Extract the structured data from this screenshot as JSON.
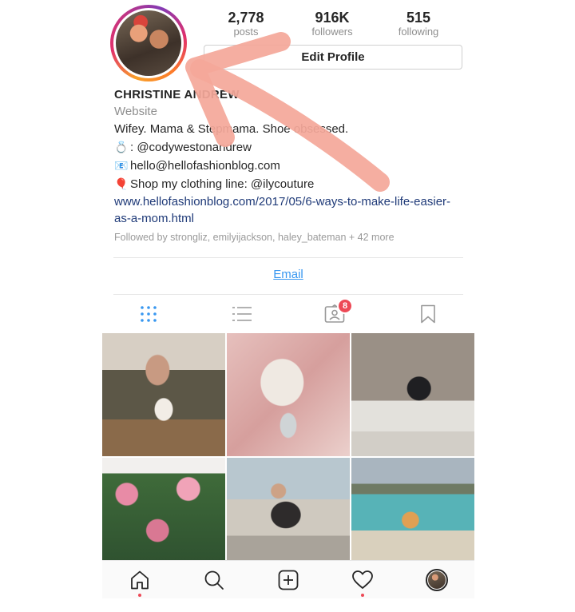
{
  "profile": {
    "posts_count": "2,778",
    "posts_label": "posts",
    "followers_count": "916K",
    "followers_label": "followers",
    "following_count": "515",
    "following_label": "following",
    "edit_button": "Edit Profile",
    "name": "CHRISTINE ANDREW",
    "website_label": "Website",
    "bio_line1": "Wifey. Mama & Stepmama. Shoe obsessed.",
    "bio_line2_glyph": "💍",
    "bio_line2": ": @codywestonandrew",
    "bio_line3_glyph": "📧",
    "bio_line3": "hello@hellofashionblog.com",
    "bio_line4_glyph": "🎈",
    "bio_line4": "Shop my clothing line: @ilycouture",
    "link": "www.hellofashionblog.com/2017/05/6-ways-to-make-life-easier-as-a-mom.html",
    "followed_by": "Followed by strongliz, emilyijackson, haley_bateman + 42 more",
    "email_button": "Email"
  },
  "tabs": {
    "items": [
      "grid-icon",
      "list-icon",
      "tagged-icon",
      "saved-icon"
    ],
    "tagged_badge": "8"
  },
  "grid": {
    "tiles": [
      "tile-1",
      "tile-2",
      "tile-3",
      "tile-4",
      "tile-5",
      "tile-6"
    ]
  },
  "bottom_nav": {
    "items": [
      "home-icon",
      "search-icon",
      "add-icon",
      "activity-icon",
      "profile-avatar"
    ]
  },
  "colors": {
    "link_blue": "#3897f0",
    "badge_red": "#ed4956",
    "arrow_salmon": "#f4a89a"
  }
}
